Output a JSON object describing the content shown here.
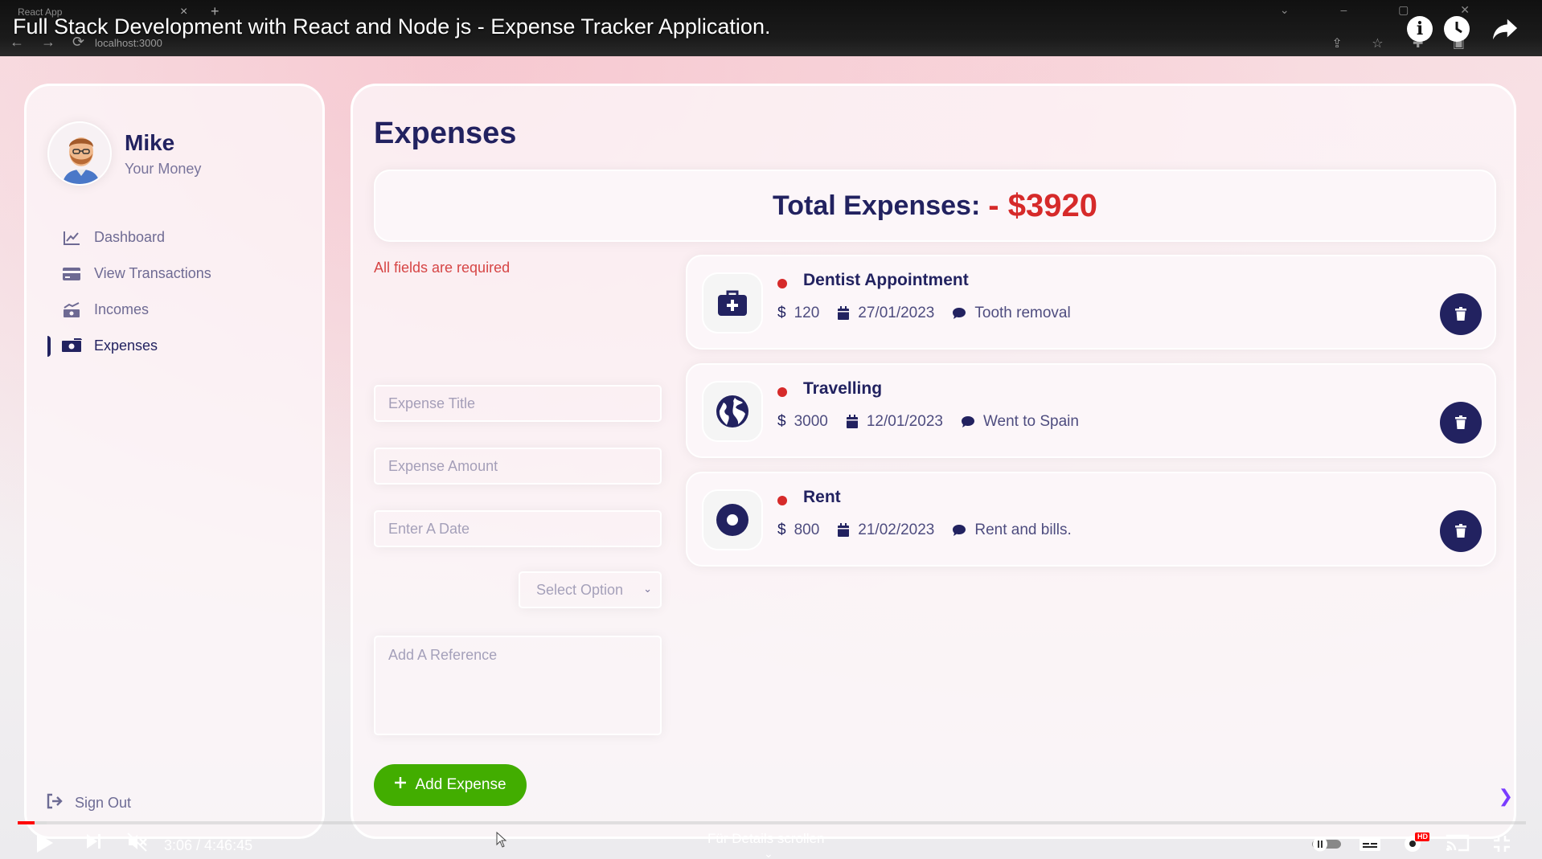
{
  "browser": {
    "tab_title": "React App",
    "url": "localhost:3000"
  },
  "video": {
    "title": "Full Stack Development with React and Node js - Expense Tracker Application.",
    "current_time": "3:06",
    "duration": "4:46:45",
    "time_display": "3:06 / 4:46:45",
    "scroll_hint": "Für Details scrollen",
    "progress_fraction": 0.011,
    "quality_badge": "HD"
  },
  "user": {
    "name": "Mike",
    "subtitle": "Your Money"
  },
  "menu": {
    "items": [
      {
        "label": "Dashboard",
        "icon": "chart-line-icon"
      },
      {
        "label": "View Transactions",
        "icon": "credit-card-icon"
      },
      {
        "label": "Incomes",
        "icon": "money-trend-icon"
      },
      {
        "label": "Expenses",
        "icon": "money-bill-icon",
        "active": true
      }
    ],
    "signout": "Sign Out"
  },
  "page": {
    "title": "Expenses",
    "total_label": "Total Expenses:",
    "total_value": "- $3920"
  },
  "form": {
    "error": "All fields are required",
    "title_placeholder": "Expense Title",
    "amount_placeholder": "Expense Amount",
    "date_placeholder": "Enter A Date",
    "category_placeholder": "Select Option",
    "reference_placeholder": "Add A Reference",
    "submit_label": "Add Expense"
  },
  "expenses": [
    {
      "title": "Dentist Appointment",
      "amount": "120",
      "date": "27/01/2023",
      "description": "Tooth removal",
      "icon": "medical-kit-icon"
    },
    {
      "title": "Travelling",
      "amount": "3000",
      "date": "12/01/2023",
      "description": "Went to Spain",
      "icon": "globe-icon"
    },
    {
      "title": "Rent",
      "amount": "800",
      "date": "21/02/2023",
      "description": "Rent and bills.",
      "icon": "circle-dot-icon"
    }
  ],
  "colors": {
    "primary": "#222260",
    "danger": "#d62a2a",
    "success": "#42ad00",
    "panel": "#fcf6f9"
  },
  "symbols": {
    "currency": "$"
  }
}
